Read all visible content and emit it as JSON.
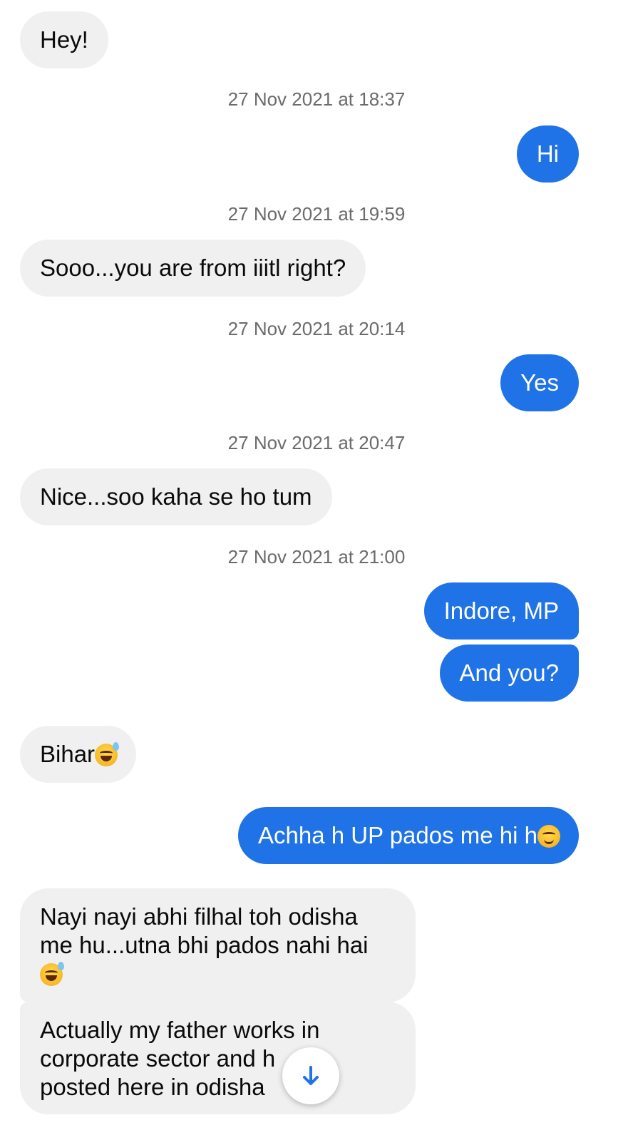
{
  "messages": [
    {
      "id": "m1",
      "direction": "incoming",
      "text": "Hey!"
    },
    {
      "id": "ts1",
      "timestamp": "27 Nov 2021 at 18:37"
    },
    {
      "id": "m2",
      "direction": "outgoing",
      "text": "Hi"
    },
    {
      "id": "ts2",
      "timestamp": "27 Nov 2021 at 19:59"
    },
    {
      "id": "m3",
      "direction": "incoming",
      "text": "Sooo...you are from iiitl right?"
    },
    {
      "id": "ts3",
      "timestamp": "27 Nov 2021 at 20:14"
    },
    {
      "id": "m4",
      "direction": "outgoing",
      "text": "Yes"
    },
    {
      "id": "ts4",
      "timestamp": "27 Nov 2021 at 20:47"
    },
    {
      "id": "m5",
      "direction": "incoming",
      "text": "Nice...soo kaha se ho tum"
    },
    {
      "id": "ts5",
      "timestamp": "27 Nov 2021 at 21:00"
    },
    {
      "id": "m6",
      "direction": "outgoing",
      "text": "Indore, MP"
    },
    {
      "id": "m7",
      "direction": "outgoing",
      "text": "And you?"
    },
    {
      "id": "m8",
      "direction": "incoming",
      "text": "Bihar",
      "emoji": "grinning-sweat-emoji"
    },
    {
      "id": "m9",
      "direction": "outgoing",
      "text": "Achha h UP pados me hi h",
      "emoji": "relieved-face-emoji"
    },
    {
      "id": "m10",
      "direction": "incoming",
      "text": "Nayi nayi abhi filhal toh odisha me hu...utna bhi pados nahi hai",
      "emoji": "grinning-sweat-emoji"
    },
    {
      "id": "m11",
      "direction": "incoming",
      "text": "Actually my father works in corporate sector and h",
      "text_line3": "posted here in odisha"
    }
  ],
  "colors": {
    "outgoing_bubble": "#1f73e6",
    "incoming_bubble": "#f0f0f0",
    "timestamp": "#6b6b6b"
  },
  "scroll_button": {
    "icon": "arrow-down-icon"
  }
}
